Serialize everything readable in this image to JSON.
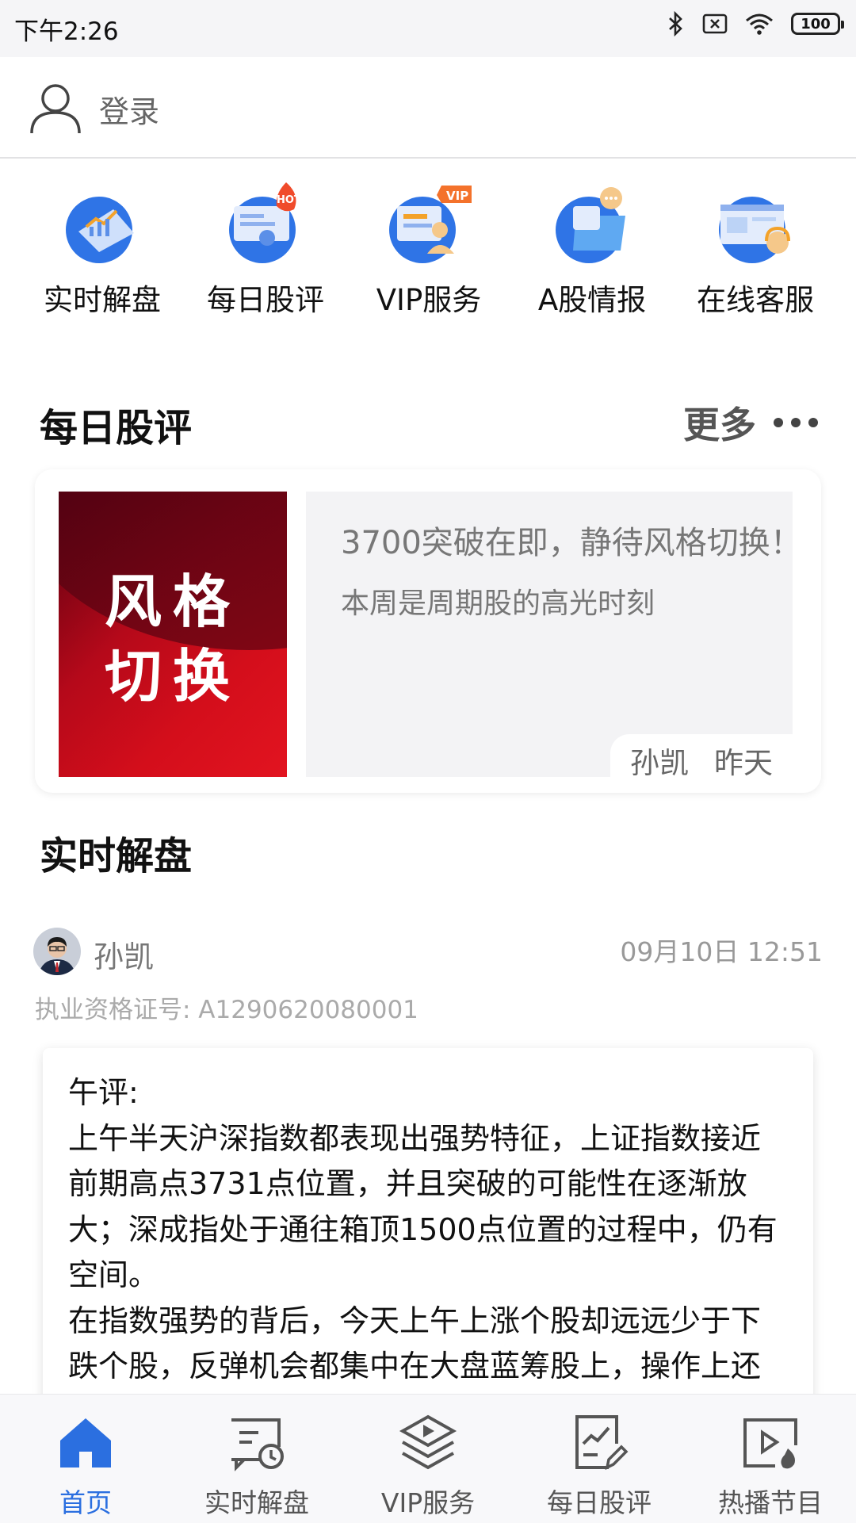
{
  "status_bar": {
    "time": "下午2:26",
    "battery": "100"
  },
  "header": {
    "login_label": "登录"
  },
  "quick_entries": [
    {
      "label": "实时解盘",
      "icon": "chart-laptop-icon"
    },
    {
      "label": "每日股评",
      "icon": "hot-review-icon"
    },
    {
      "label": "VIP服务",
      "icon": "vip-service-icon"
    },
    {
      "label": "A股情报",
      "icon": "folder-chat-icon"
    },
    {
      "label": "在线客服",
      "icon": "headset-support-icon"
    }
  ],
  "daily_review": {
    "section_title": "每日股评",
    "more_label": "更多",
    "card": {
      "thumbnail_text_line1": "风格",
      "thumbnail_text_line2": "切换",
      "title": "3700突破在即，静待风格切换！",
      "subtitle": "本周是周期股的高光时刻",
      "author": "孙凯",
      "date": "昨天"
    }
  },
  "live_analysis": {
    "section_title": "实时解盘",
    "post": {
      "author": "孙凯",
      "time": "09月10日 12:51",
      "license": "执业资格证号: A1290620080001",
      "paragraphs": [
        "午评:",
        "上午半天沪深指数都表现出强势特征，上证指数接近前期高点3731点位置，并且突破的可能性在逐渐放大；深成指处于通往箱顶1500点位置的过程中，仍有空间。",
        "在指数强势的背后，今天上午上涨个股却远远少于下跌个股，反弹机会都集中在大盘蓝筹股上，操作上还需谨慎，注意控制仓位。"
      ]
    }
  },
  "bottom_nav": {
    "items": [
      {
        "label": "首页",
        "icon": "home-icon",
        "active": true
      },
      {
        "label": "实时解盘",
        "icon": "live-chat-clock-icon"
      },
      {
        "label": "VIP服务",
        "icon": "layers-play-icon"
      },
      {
        "label": "每日股评",
        "icon": "document-chart-edit-icon"
      },
      {
        "label": "热播节目",
        "icon": "hot-video-icon"
      }
    ]
  },
  "colors": {
    "accent": "#2b6fe0",
    "thumbnail_red": "#d40e1b"
  }
}
